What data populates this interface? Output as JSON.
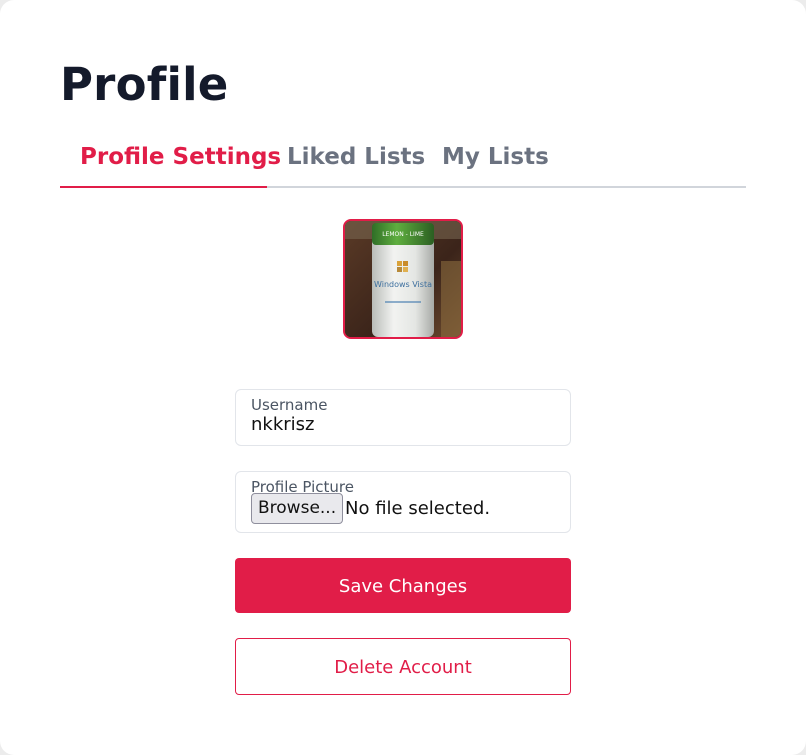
{
  "page": {
    "title": "Profile"
  },
  "tabs": [
    {
      "label": "Profile Settings",
      "active": true
    },
    {
      "label": "Liked Lists",
      "active": false
    },
    {
      "label": "My Lists",
      "active": false
    }
  ],
  "avatar": {
    "can_label_top": "LEMON - LIME",
    "can_brand": "Windows Vista"
  },
  "form": {
    "username_label": "Username",
    "username_value": "nkkrisz",
    "picture_label": "Profile Picture",
    "browse_label": "Browse...",
    "file_status": "No file selected."
  },
  "actions": {
    "save_label": "Save Changes",
    "delete_label": "Delete Account"
  },
  "colors": {
    "accent": "#e11d48",
    "title": "#141a2b",
    "tab_inactive": "#6b7280"
  }
}
